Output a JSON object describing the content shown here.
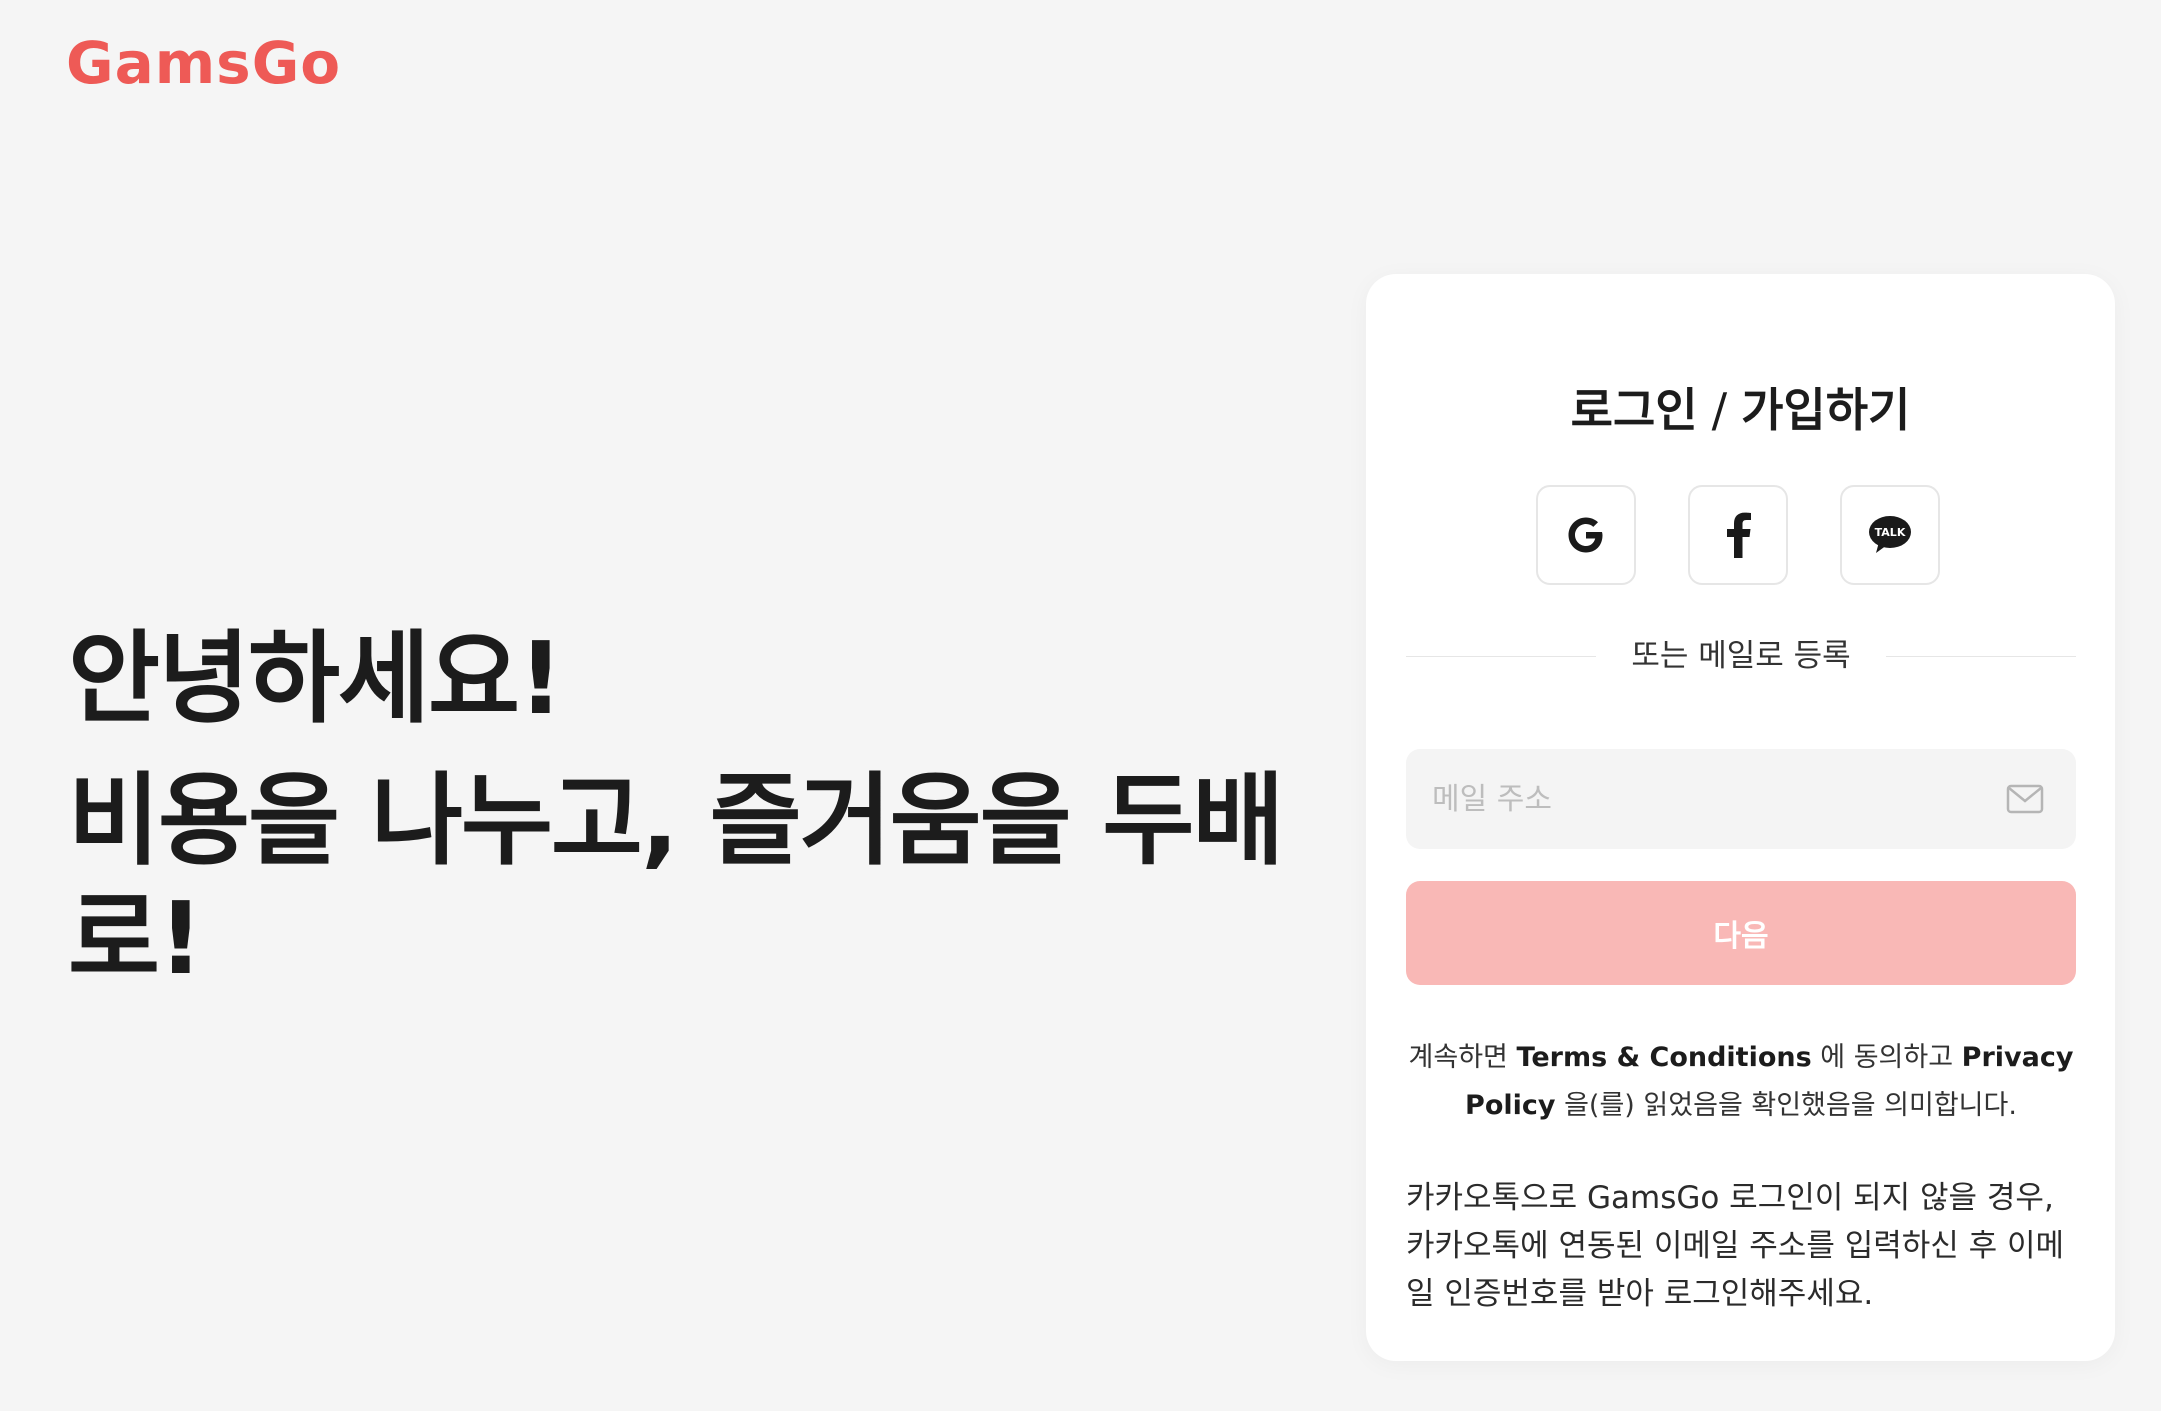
{
  "brand": {
    "logo_text": "GamsGo",
    "color": "#ee5a56"
  },
  "hero": {
    "greeting": "안녕하세요!",
    "tagline": "비용을 나누고, 즐거움을 두배로!"
  },
  "login_card": {
    "title_login": "로그인",
    "title_separator": "/",
    "title_signup": "가입하기",
    "social_buttons": [
      {
        "name": "Google",
        "icon": "google-icon"
      },
      {
        "name": "Facebook",
        "icon": "facebook-icon"
      },
      {
        "name": "KakaoTalk",
        "icon": "kakao-talk-icon"
      }
    ],
    "divider_text": "또는 메일로 등록",
    "email": {
      "placeholder": "메일 주소",
      "value": ""
    },
    "next_button_label": "다음",
    "next_button_color": "#f9b8b6",
    "terms": {
      "prefix": "계속하면",
      "terms_link": "Terms & Conditions",
      "middle": "에 동의하고",
      "privacy_link": "Privacy Policy",
      "suffix": "을(를) 읽었음을 확인했음을 의미합니다."
    },
    "kakao_note": "카카오톡으로 GamsGo 로그인이 되지 않을 경우, 카카오톡에 연동된 이메일 주소를 입력하신 후 이메일 인증번호를 받아 로그인해주세요."
  }
}
